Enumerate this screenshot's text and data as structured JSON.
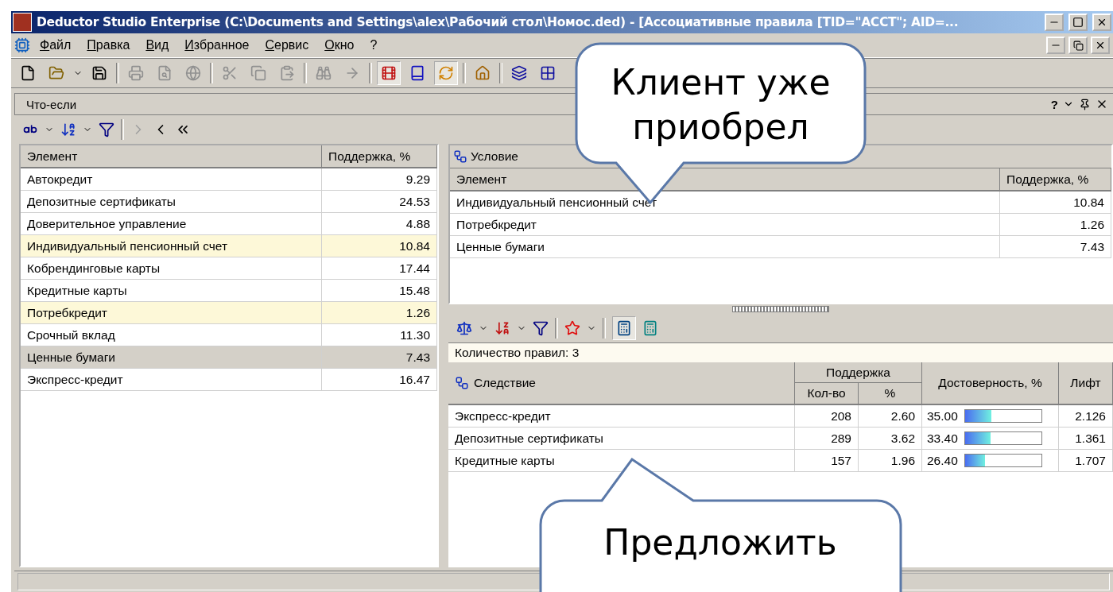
{
  "window": {
    "title": "Deductor Studio Enterprise (C:\\Documents and Settings\\alex\\Рабочий стол\\Номос.ded) - [Ассоциативные правила [TID=\"ACCT\"; AID=..."
  },
  "menu": [
    {
      "label": "Файл"
    },
    {
      "label": "Правка"
    },
    {
      "label": "Вид"
    },
    {
      "label": "Избранное"
    },
    {
      "label": "Сервис"
    },
    {
      "label": "Окно"
    },
    {
      "label": "?"
    }
  ],
  "panel": {
    "title": "Что-если",
    "help": "?"
  },
  "elements": {
    "columns": [
      "Элемент",
      "Поддержка, %"
    ],
    "rows": [
      {
        "name": "Автокредит",
        "support": "9.29",
        "highlighted": false,
        "selected": false
      },
      {
        "name": "Депозитные сертификаты",
        "support": "24.53",
        "highlighted": false,
        "selected": false
      },
      {
        "name": "Доверительное управление",
        "support": "4.88",
        "highlighted": false,
        "selected": false
      },
      {
        "name": "Индивидуальный пенсионный счет",
        "support": "10.84",
        "highlighted": true,
        "selected": false
      },
      {
        "name": "Кобрендинговые карты",
        "support": "17.44",
        "highlighted": false,
        "selected": false
      },
      {
        "name": "Кредитные карты",
        "support": "15.48",
        "highlighted": false,
        "selected": false
      },
      {
        "name": "Потребкредит",
        "support": "1.26",
        "highlighted": true,
        "selected": false
      },
      {
        "name": "Срочный вклад",
        "support": "11.30",
        "highlighted": false,
        "selected": false
      },
      {
        "name": "Ценные бумаги",
        "support": "7.43",
        "highlighted": true,
        "selected": true
      },
      {
        "name": "Экспресс-кредит",
        "support": "16.47",
        "highlighted": false,
        "selected": false
      }
    ]
  },
  "condition": {
    "title": "Условие",
    "columns": [
      "Элемент",
      "Поддержка, %"
    ],
    "rows": [
      {
        "name": "Индивидуальный пенсионный счет",
        "support": "10.84"
      },
      {
        "name": "Потребкредит",
        "support": "1.26"
      },
      {
        "name": "Ценные бумаги",
        "support": "7.43"
      }
    ]
  },
  "rules": {
    "count": "Количество правил: 3",
    "consequence": "Следствие",
    "support_group": "Поддержка",
    "columns": [
      "Кол-во",
      "%",
      "Достоверность, %",
      "Лифт"
    ],
    "rows": [
      {
        "name": "Экспресс-кредит",
        "count": "208",
        "percent": "2.60",
        "confidence": "35.00",
        "level": 0.35,
        "lift": "2.126"
      },
      {
        "name": "Депозитные сертификаты",
        "count": "289",
        "percent": "3.62",
        "confidence": "33.40",
        "level": 0.334,
        "lift": "1.361"
      },
      {
        "name": "Кредитные карты",
        "count": "157",
        "percent": "1.96",
        "confidence": "26.40",
        "level": 0.264,
        "lift": "1.707"
      }
    ]
  },
  "callouts": [
    {
      "text": "Клиент уже приобрел"
    },
    {
      "text": "Предложить"
    }
  ]
}
